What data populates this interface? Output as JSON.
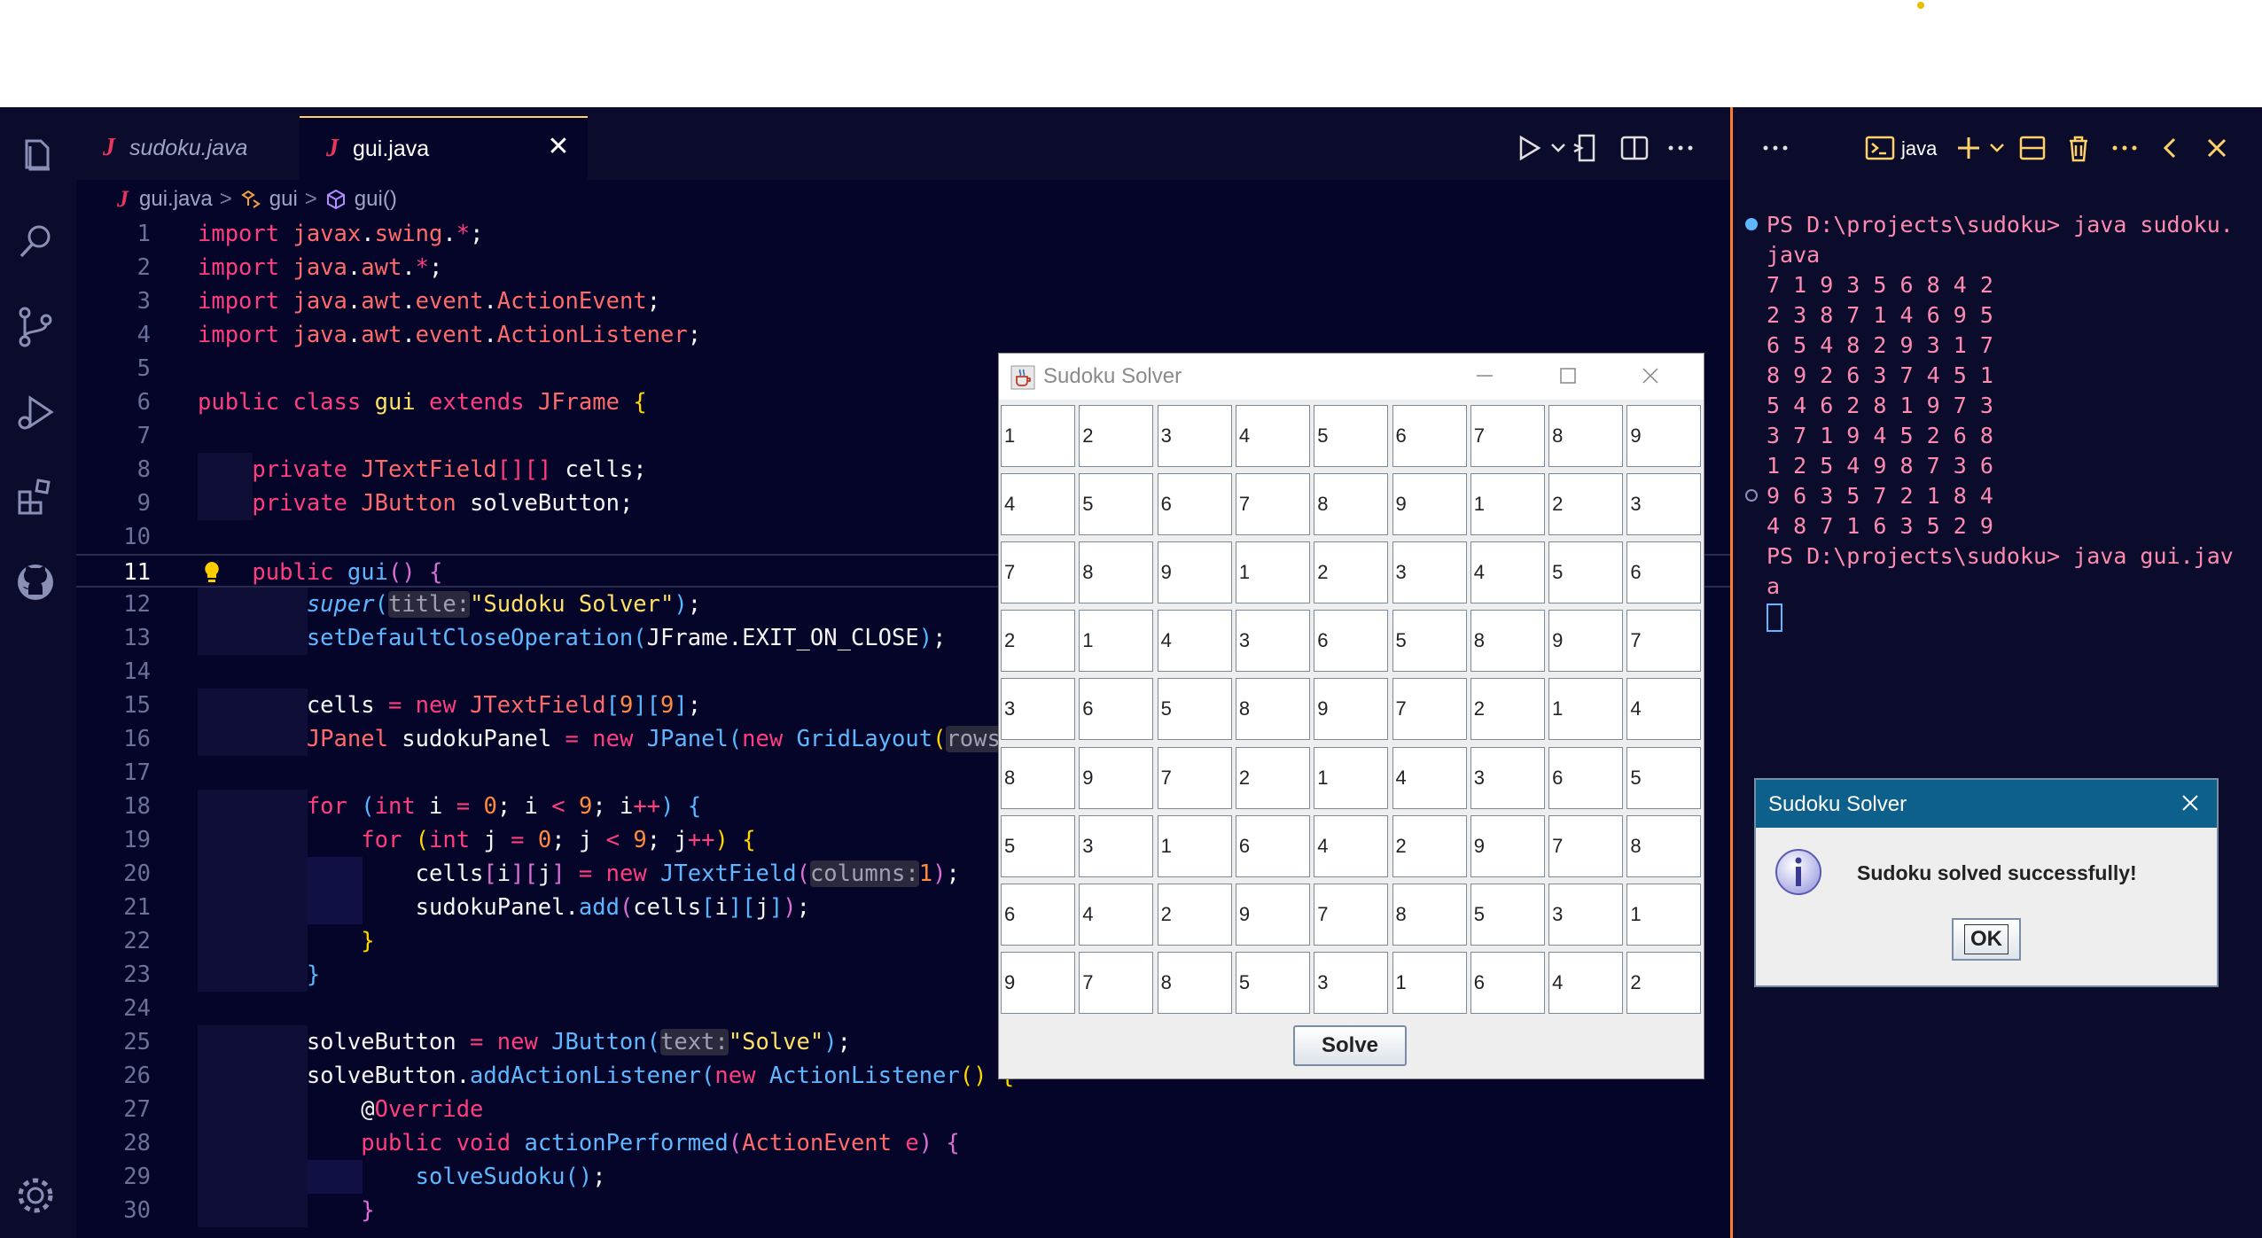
{
  "tabs": [
    {
      "label": "sudoku.java",
      "icon": "java-file-icon"
    },
    {
      "label": "gui.java",
      "icon": "java-file-icon"
    }
  ],
  "breadcrumb": {
    "file": "gui.java",
    "cls": "gui",
    "method": "gui()"
  },
  "line_numbers": [
    "1",
    "2",
    "3",
    "4",
    "5",
    "6",
    "7",
    "8",
    "9",
    "10",
    "11",
    "12",
    "13",
    "14",
    "15",
    "16",
    "17",
    "18",
    "19",
    "20",
    "21",
    "22",
    "23",
    "24",
    "25",
    "26",
    "27",
    "28",
    "29",
    "30"
  ],
  "code": {
    "l1": [
      [
        "kw",
        "import "
      ],
      [
        "ty",
        "javax"
      ],
      [
        "",
        "."
      ],
      [
        "ty",
        "swing"
      ],
      [
        "",
        "."
      ],
      [
        "kw",
        "*"
      ],
      [
        "",
        ";"
      ]
    ],
    "l2": [
      [
        "kw",
        "import "
      ],
      [
        "ty",
        "java"
      ],
      [
        "",
        "."
      ],
      [
        "ty",
        "awt"
      ],
      [
        "",
        "."
      ],
      [
        "kw",
        "*"
      ],
      [
        "",
        ";"
      ]
    ],
    "l3": [
      [
        "kw",
        "import "
      ],
      [
        "ty",
        "java"
      ],
      [
        "",
        "."
      ],
      [
        "ty",
        "awt"
      ],
      [
        "",
        "."
      ],
      [
        "ty",
        "event"
      ],
      [
        "",
        "."
      ],
      [
        "ty",
        "ActionEvent"
      ],
      [
        "",
        ";"
      ]
    ],
    "l4": [
      [
        "kw",
        "import "
      ],
      [
        "ty",
        "java"
      ],
      [
        "",
        "."
      ],
      [
        "ty",
        "awt"
      ],
      [
        "",
        "."
      ],
      [
        "ty",
        "event"
      ],
      [
        "",
        "."
      ],
      [
        "ty",
        "ActionListener"
      ],
      [
        "",
        ";"
      ]
    ],
    "l5": [],
    "l6": [
      [
        "kw",
        "public class "
      ],
      [
        "cls",
        "gui "
      ],
      [
        "kw",
        "extends "
      ],
      [
        "ty",
        "JFrame "
      ],
      [
        "br",
        "{"
      ]
    ],
    "l7": [],
    "l8": [
      [
        "",
        "    "
      ],
      [
        "kw",
        "private "
      ],
      [
        "ty",
        "JTextField"
      ],
      [
        "kw",
        "[][] "
      ],
      [
        "",
        "cells;"
      ]
    ],
    "l9": [
      [
        "",
        "    "
      ],
      [
        "kw",
        "private "
      ],
      [
        "ty",
        "JButton "
      ],
      [
        "",
        "solveButton;"
      ]
    ],
    "l10": [],
    "l11": [
      [
        "",
        "    "
      ],
      [
        "kw",
        "public "
      ],
      [
        "fn",
        "gui"
      ],
      [
        "br2",
        "() {"
      ]
    ],
    "l12": [
      [
        "",
        "        "
      ],
      [
        "fni",
        "super"
      ],
      [
        "br3",
        "("
      ],
      [
        "hint",
        "title:"
      ],
      [
        "st",
        "\"Sudoku Solver\""
      ],
      [
        "br3",
        ")"
      ],
      [
        "",
        ";"
      ]
    ],
    "l13": [
      [
        "",
        "        "
      ],
      [
        "fn",
        "setDefaultCloseOperation"
      ],
      [
        "br3",
        "("
      ],
      [
        "",
        "JFrame.EXIT_ON_CLOSE"
      ],
      [
        "br3",
        ")"
      ],
      [
        "",
        ";"
      ]
    ],
    "l14": [],
    "l15": [
      [
        "",
        "        cells "
      ],
      [
        "kw",
        "= new "
      ],
      [
        "ty",
        "JTextField"
      ],
      [
        "br3",
        "["
      ],
      [
        "num",
        "9"
      ],
      [
        "br3",
        "]["
      ],
      [
        "num",
        "9"
      ],
      [
        "br3",
        "]"
      ],
      [
        "",
        ";"
      ]
    ],
    "l16": [
      [
        "",
        "        "
      ],
      [
        "ty",
        "JPanel "
      ],
      [
        "",
        "sudokuPanel "
      ],
      [
        "kw",
        "= new "
      ],
      [
        "fn",
        "JPanel"
      ],
      [
        "br3",
        "("
      ],
      [
        "kw",
        "new "
      ],
      [
        "fn",
        "GridLayout"
      ],
      [
        "br",
        "("
      ],
      [
        "hint",
        "rows"
      ]
    ],
    "l17": [],
    "l18": [
      [
        "",
        "        "
      ],
      [
        "kw",
        "for "
      ],
      [
        "br3",
        "("
      ],
      [
        "kw",
        "int "
      ],
      [
        "",
        "i "
      ],
      [
        "kw",
        "= "
      ],
      [
        "num",
        "0"
      ],
      [
        "",
        "; i "
      ],
      [
        "kw",
        "< "
      ],
      [
        "num",
        "9"
      ],
      [
        "",
        "; i"
      ],
      [
        "kw",
        "++"
      ],
      [
        "br3",
        ") "
      ],
      [
        "br3",
        "{"
      ]
    ],
    "l19": [
      [
        "",
        "            "
      ],
      [
        "kw",
        "for "
      ],
      [
        "br",
        "("
      ],
      [
        "kw",
        "int "
      ],
      [
        "",
        "j "
      ],
      [
        "kw",
        "= "
      ],
      [
        "num",
        "0"
      ],
      [
        "",
        "; j "
      ],
      [
        "kw",
        "< "
      ],
      [
        "num",
        "9"
      ],
      [
        "",
        "; j"
      ],
      [
        "kw",
        "++"
      ],
      [
        "br",
        ") {"
      ]
    ],
    "l20": [
      [
        "",
        "                cells"
      ],
      [
        "br2",
        "["
      ],
      [
        "",
        "i"
      ],
      [
        "br2",
        "]["
      ],
      [
        "",
        "j"
      ],
      [
        "br2",
        "] "
      ],
      [
        "kw",
        "= new "
      ],
      [
        "fn",
        "JTextField"
      ],
      [
        "br2",
        "("
      ],
      [
        "hint",
        "columns:"
      ],
      [
        "num",
        "1"
      ],
      [
        "br2",
        ")"
      ],
      [
        "",
        ";"
      ]
    ],
    "l21": [
      [
        "",
        "                sudokuPanel."
      ],
      [
        "fn",
        "add"
      ],
      [
        "br2",
        "("
      ],
      [
        "",
        "cells"
      ],
      [
        "br3",
        "["
      ],
      [
        "",
        "i"
      ],
      [
        "br3",
        "]["
      ],
      [
        "",
        "j"
      ],
      [
        "br3",
        "]"
      ],
      [
        "br2",
        ")"
      ],
      [
        "",
        ";"
      ]
    ],
    "l22": [
      [
        "",
        "            "
      ],
      [
        "br",
        "}"
      ]
    ],
    "l23": [
      [
        "",
        "        "
      ],
      [
        "br3",
        "}"
      ]
    ],
    "l24": [],
    "l25": [
      [
        "",
        "        solveButton "
      ],
      [
        "kw",
        "= new "
      ],
      [
        "fn",
        "JButton"
      ],
      [
        "br3",
        "("
      ],
      [
        "hint",
        "text:"
      ],
      [
        "st",
        "\"Solve\""
      ],
      [
        "br3",
        ")"
      ],
      [
        "",
        ";"
      ]
    ],
    "l26": [
      [
        "",
        "        solveButton."
      ],
      [
        "fn",
        "addActionListener"
      ],
      [
        "br3",
        "("
      ],
      [
        "kw",
        "new "
      ],
      [
        "fn",
        "ActionListener"
      ],
      [
        "br",
        "() {"
      ]
    ],
    "l27": [
      [
        "",
        "            @"
      ],
      [
        "anno",
        "Override"
      ]
    ],
    "l28": [
      [
        "",
        "            "
      ],
      [
        "kw",
        "public void "
      ],
      [
        "fn",
        "actionPerformed"
      ],
      [
        "br2",
        "("
      ],
      [
        "ty",
        "ActionEvent "
      ],
      [
        "kw",
        "e"
      ],
      [
        "br2",
        ") {"
      ]
    ],
    "l29": [
      [
        "",
        "                "
      ],
      [
        "fn",
        "solveSudoku"
      ],
      [
        "br3",
        "()"
      ],
      [
        "",
        ";"
      ]
    ],
    "l30": [
      [
        "",
        "            "
      ],
      [
        "br2",
        "}"
      ]
    ]
  },
  "sudoku_window": {
    "title": "Sudoku Solver",
    "cells": [
      [
        "1",
        "2",
        "3",
        "4",
        "5",
        "6",
        "7",
        "8",
        "9"
      ],
      [
        "4",
        "5",
        "6",
        "7",
        "8",
        "9",
        "1",
        "2",
        "3"
      ],
      [
        "7",
        "8",
        "9",
        "1",
        "2",
        "3",
        "4",
        "5",
        "6"
      ],
      [
        "2",
        "1",
        "4",
        "3",
        "6",
        "5",
        "8",
        "9",
        "7"
      ],
      [
        "3",
        "6",
        "5",
        "8",
        "9",
        "7",
        "2",
        "1",
        "4"
      ],
      [
        "8",
        "9",
        "7",
        "2",
        "1",
        "4",
        "3",
        "6",
        "5"
      ],
      [
        "5",
        "3",
        "1",
        "6",
        "4",
        "2",
        "9",
        "7",
        "8"
      ],
      [
        "6",
        "4",
        "2",
        "9",
        "7",
        "8",
        "5",
        "3",
        "1"
      ],
      [
        "9",
        "7",
        "8",
        "5",
        "3",
        "1",
        "6",
        "4",
        "2"
      ]
    ],
    "solve_label": "Solve"
  },
  "terminal": {
    "shell_label": "java",
    "lines": [
      "PS D:\\projects\\sudoku> java sudoku.",
      "java",
      "7 1 9 3 5 6 8 4 2",
      "2 3 8 7 1 4 6 9 5",
      "6 5 4 8 2 9 3 1 7",
      "8 9 2 6 3 7 4 5 1",
      "5 4 6 2 8 1 9 7 3",
      "3 7 1 9 4 5 2 6 8",
      "1 2 5 4 9 8 7 3 6",
      "9 6 3 5 7 2 1 8 4",
      "4 8 7 1 6 3 5 2 9",
      "PS D:\\projects\\sudoku> java gui.jav",
      "a"
    ]
  },
  "dialog": {
    "title": "Sudoku Solver",
    "message": "Sudoku solved successfully!",
    "ok_label": "OK"
  },
  "colors": {
    "editor_bg": "#05052a",
    "keyword": "#ff3d7f",
    "type": "#ff6a6a",
    "function": "#5fb7ff",
    "string": "#ffe066",
    "accent_divider": "#ff7b2e",
    "terminal_text": "#ff8ab0",
    "dialog_title_bg": "#0d5f8c"
  }
}
